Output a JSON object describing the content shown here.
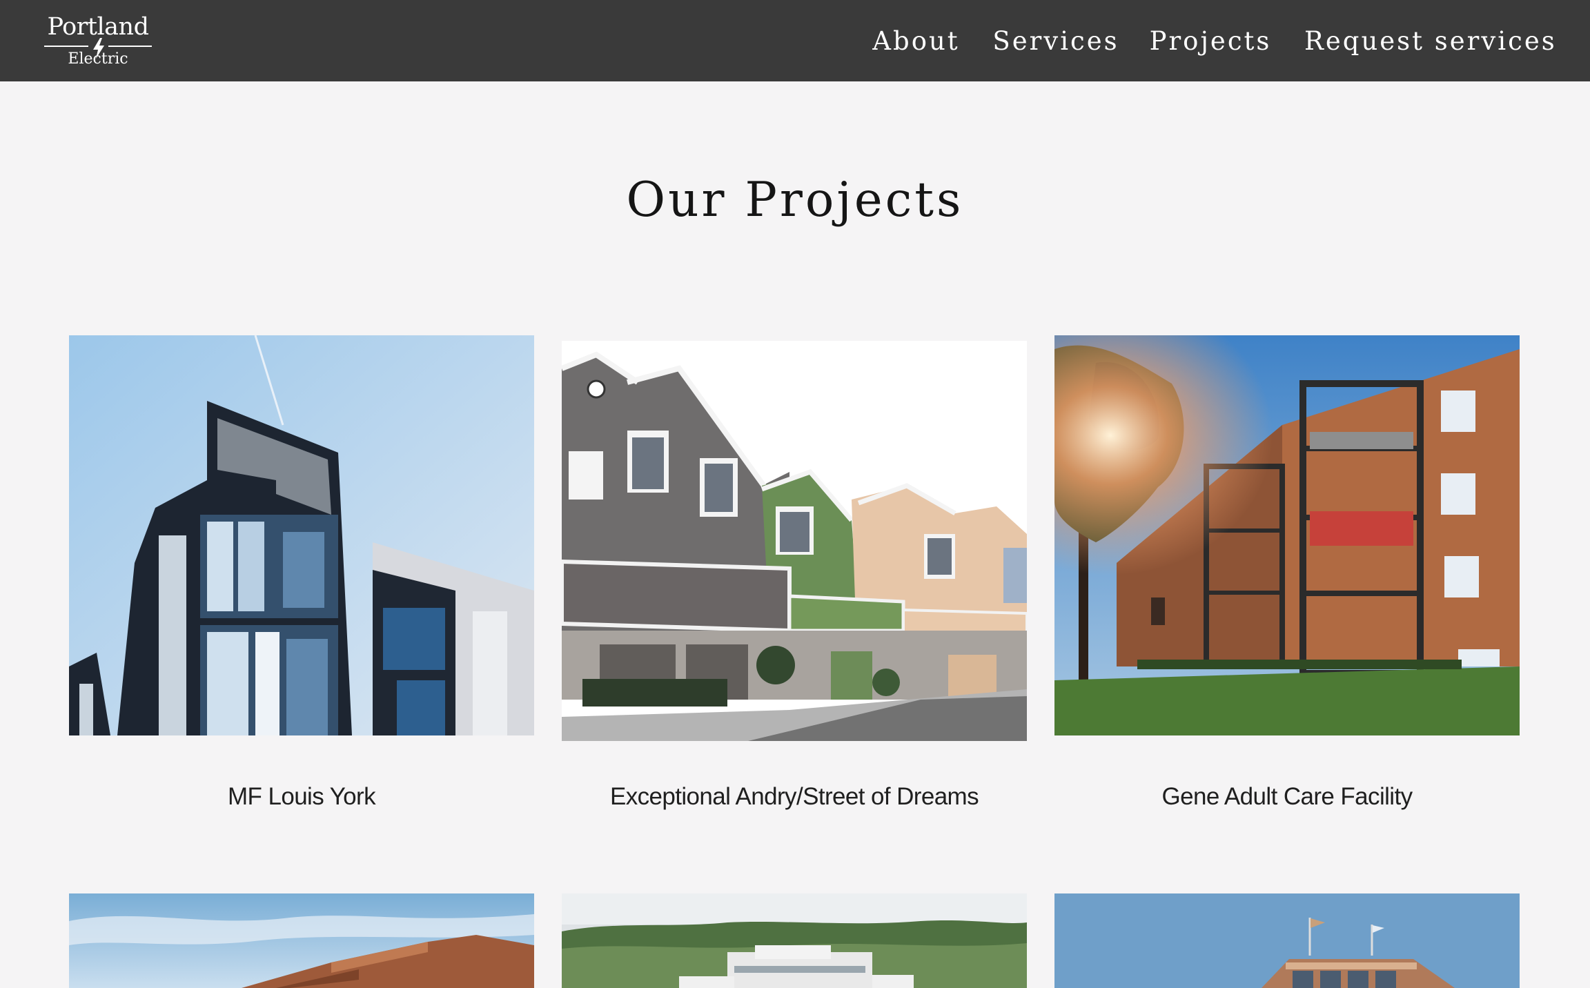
{
  "brand": {
    "name_line1": "Portland",
    "name_line2": "Electric"
  },
  "nav": {
    "items": [
      {
        "label": "About"
      },
      {
        "label": "Services"
      },
      {
        "label": "Projects"
      },
      {
        "label": "Request services"
      }
    ]
  },
  "page": {
    "title": "Our Projects"
  },
  "projects": [
    {
      "name": "MF Louis York",
      "image_icon": "modern-apartment-building-photo"
    },
    {
      "name": "Exceptional Andry/Street of Dreams",
      "image_icon": "townhouse-row-photo"
    },
    {
      "name": "Gene Adult Care Facility",
      "image_icon": "brick-apartment-balconies-photo"
    },
    {
      "name": "",
      "image_icon": "brick-building-sky-photo"
    },
    {
      "name": "",
      "image_icon": "aerial-office-campus-photo"
    },
    {
      "name": "",
      "image_icon": "glass-tower-flags-photo"
    }
  ],
  "colors": {
    "header_bg": "#3a3a3a",
    "page_bg": "#f5f4f5",
    "nav_text": "#ffffff"
  }
}
